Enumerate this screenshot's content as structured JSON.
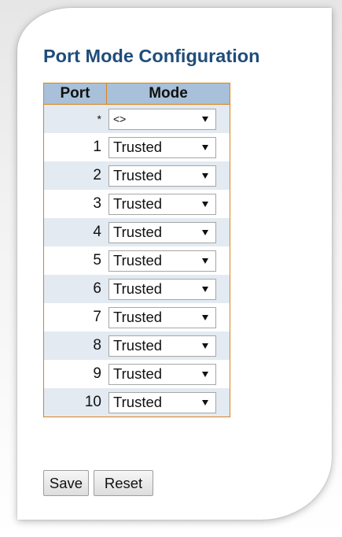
{
  "title": "Port Mode Configuration",
  "table": {
    "headers": {
      "port": "Port",
      "mode": "Mode"
    },
    "all_row": {
      "port": "*",
      "mode": "<>"
    },
    "rows": [
      {
        "port": "1",
        "mode": "Trusted"
      },
      {
        "port": "2",
        "mode": "Trusted"
      },
      {
        "port": "3",
        "mode": "Trusted"
      },
      {
        "port": "4",
        "mode": "Trusted"
      },
      {
        "port": "5",
        "mode": "Trusted"
      },
      {
        "port": "6",
        "mode": "Trusted"
      },
      {
        "port": "7",
        "mode": "Trusted"
      },
      {
        "port": "8",
        "mode": "Trusted"
      },
      {
        "port": "9",
        "mode": "Trusted"
      },
      {
        "port": "10",
        "mode": "Trusted"
      }
    ]
  },
  "buttons": {
    "save": "Save",
    "reset": "Reset"
  },
  "colors": {
    "title": "#1f4d7a",
    "header_bg": "#a8c0d9",
    "table_border": "#d8841f",
    "alt_row_bg": "#e3eaf2"
  },
  "icons": {
    "dropdown": "triangle-down-icon"
  }
}
